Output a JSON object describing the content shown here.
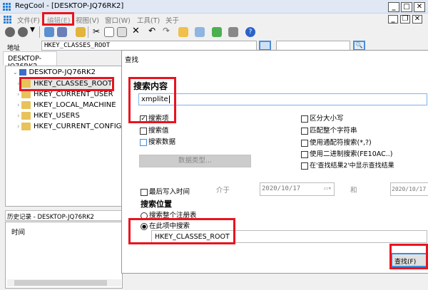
{
  "window": {
    "title": "RegCool - [DESKTOP-JQ76RK2]"
  },
  "menu": [
    "文件(F)",
    "编辑(E)",
    "视图(V)",
    "窗口(W)",
    "工具(T)",
    "关于"
  ],
  "address": {
    "label": "地址",
    "value": "HKEY_CLASSES_ROOT",
    "search_value": ""
  },
  "tab": "DESKTOP-JQ76RK2",
  "tree": {
    "root": "DESKTOP-JQ76RK2",
    "items": [
      "HKEY_CLASSES_ROOT",
      "HKEY_CURRENT_USER",
      "HKEY_LOCAL_MACHINE",
      "HKEY_USERS",
      "HKEY_CURRENT_CONFIG"
    ]
  },
  "history": {
    "title": "历史记录 - DESKTOP-JQ76RK2",
    "column": "时间"
  },
  "dialog": {
    "title": "查找",
    "content_heading": "搜索内容",
    "query": "xmplite",
    "left_options": [
      {
        "label": "搜索项",
        "checked": true
      },
      {
        "label": "搜索值",
        "checked": false
      },
      {
        "label": "搜索数据",
        "checked": false
      }
    ],
    "data_type_button": "数据类型...",
    "right_options": [
      {
        "label": "区分大小写",
        "checked": false
      },
      {
        "label": "匹配整个字符串",
        "checked": false
      },
      {
        "label": "使用通配符搜索(*,?)",
        "checked": false
      },
      {
        "label": "使用二进制搜索(FE10AC..)",
        "checked": false
      },
      {
        "label": "在'查找结果2'中显示查找结果",
        "checked": false
      }
    ],
    "last_write": {
      "label": "最后写入时间",
      "checked": false,
      "between": "介于",
      "from": "2020/10/17",
      "and": "和",
      "to": "2020/10/17"
    },
    "location_heading": "搜索位置",
    "location_options": [
      {
        "label": "搜索整个注册表",
        "selected": false
      },
      {
        "label": "在此项中搜索",
        "selected": true
      }
    ],
    "location_value": "HKEY_CLASSES_ROOT",
    "find_button": "查找(F)"
  }
}
